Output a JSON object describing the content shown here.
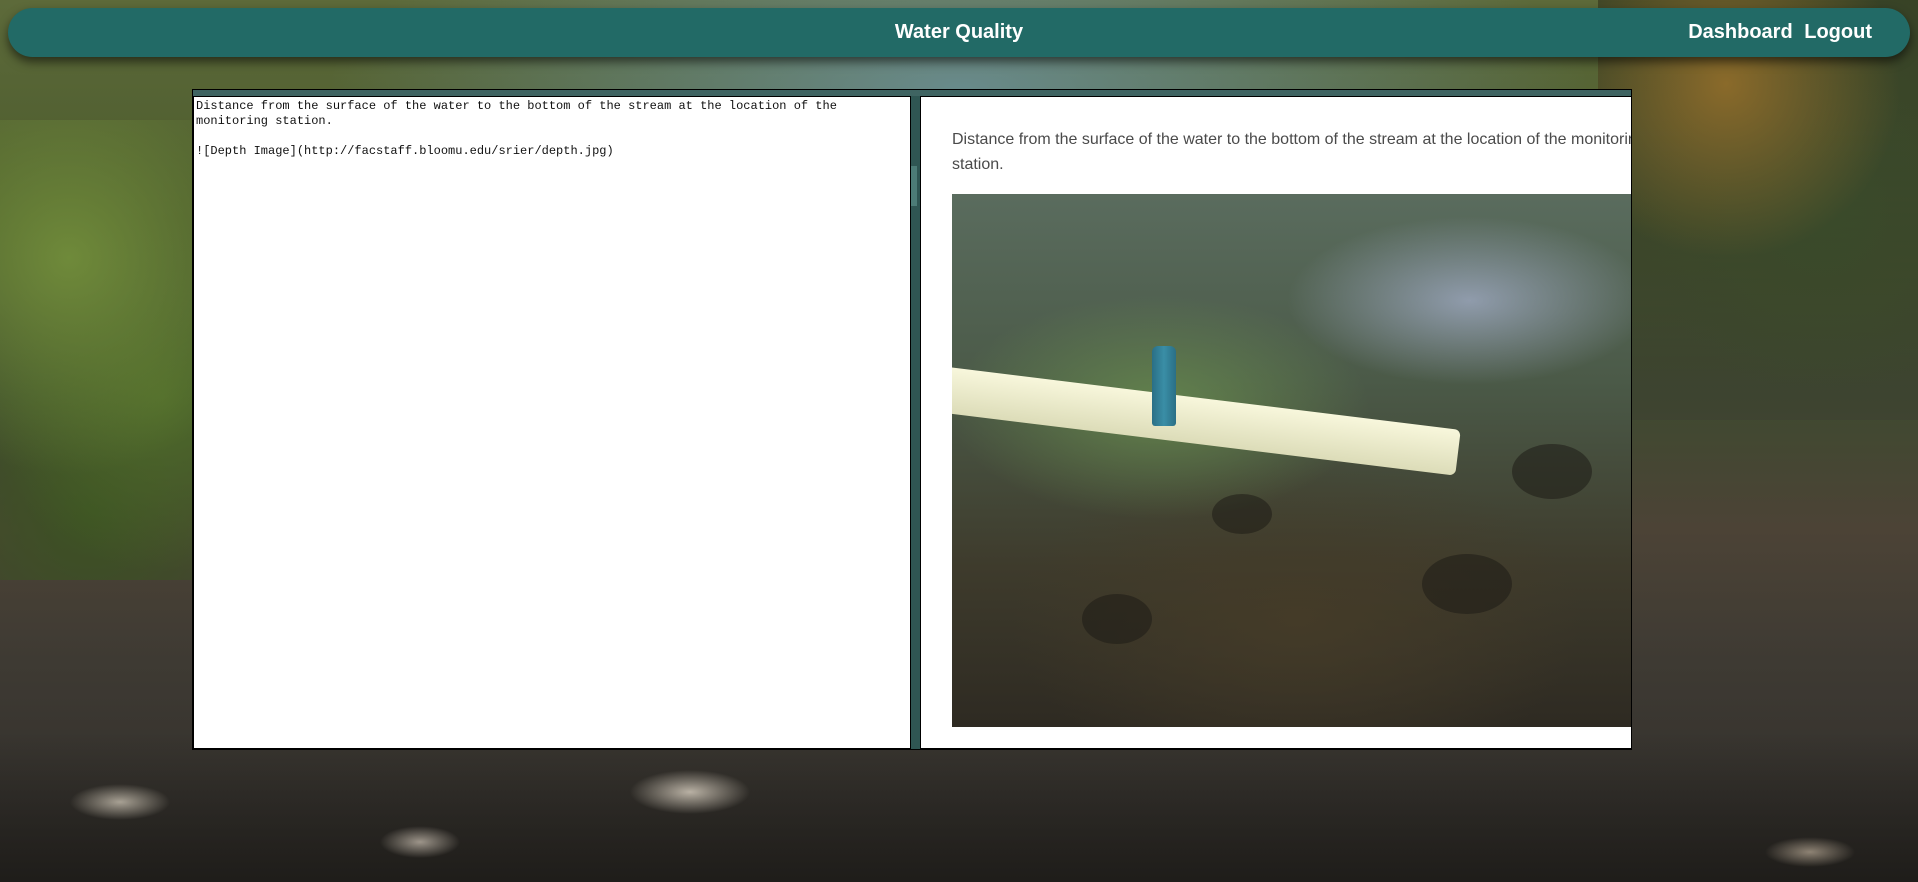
{
  "navbar": {
    "title": "Water Quality",
    "links": {
      "dashboard": "Dashboard",
      "logout": "Logout"
    }
  },
  "editor": {
    "markdown_source": "Distance from the surface of the water to the bottom of the stream at the location of the monitoring station.\n\n![Depth Image](http://facstaff.bloomu.edu/srier/depth.jpg)"
  },
  "preview": {
    "paragraph": "Distance from the surface of the water to the bottom of the stream at the location of the monitoring station.",
    "image_alt": "Depth Image"
  }
}
